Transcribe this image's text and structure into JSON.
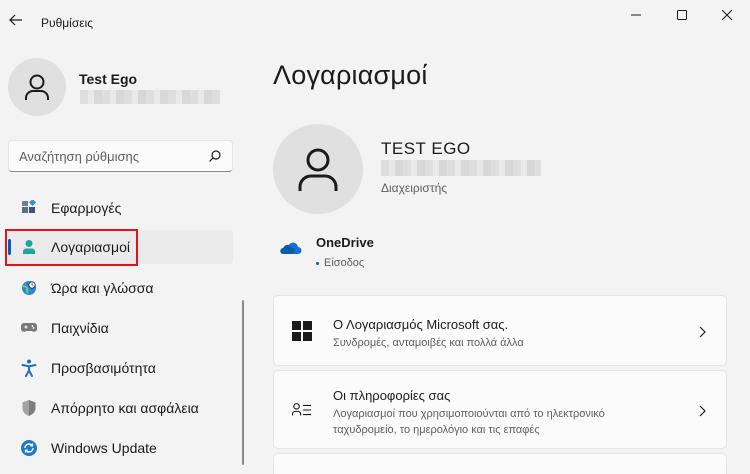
{
  "window": {
    "title": "Ρυθμίσεις",
    "controls": [
      "minimize-icon",
      "maximize-icon",
      "close-icon"
    ]
  },
  "user": {
    "name": "Test Ego"
  },
  "search": {
    "placeholder": "Αναζήτηση ρύθμισης"
  },
  "sidebar": {
    "items": [
      {
        "label": "Εφαρμογές",
        "icon": "apps-icon"
      },
      {
        "label": "Λογαριασμοί",
        "icon": "accounts-icon",
        "selected": true
      },
      {
        "label": "Ώρα και γλώσσα",
        "icon": "time-language-icon"
      },
      {
        "label": "Παιχνίδια",
        "icon": "gaming-icon"
      },
      {
        "label": "Προσβασιμότητα",
        "icon": "accessibility-icon"
      },
      {
        "label": "Απόρρητο και ασφάλεια",
        "icon": "shield-icon"
      },
      {
        "label": "Windows Update",
        "icon": "windows-update-icon"
      }
    ]
  },
  "main": {
    "title": "Λογαριασμοί",
    "account": {
      "name": "TEST EGO",
      "role": "Διαχειριστής"
    },
    "onedrive": {
      "title": "OneDrive",
      "status": "Είσοδος"
    },
    "cards": [
      {
        "icon": "microsoft-logo-icon",
        "title": "Ο Λογαριασμός Microsoft σας.",
        "description": "Συνδρομές, ανταμοιβές και πολλά άλλα"
      },
      {
        "icon": "person-info-icon",
        "title": "Οι πληροφορίες σας",
        "description": "Λογαριασμοί που χρησιμοποιούνται από το ηλεκτρονικό ταχυδρομείο, το ημερολόγιο και τις επαφές"
      }
    ]
  },
  "colors": {
    "accent": "#005fb8",
    "highlight": "#e0151b",
    "background": "#f3f3f3"
  }
}
